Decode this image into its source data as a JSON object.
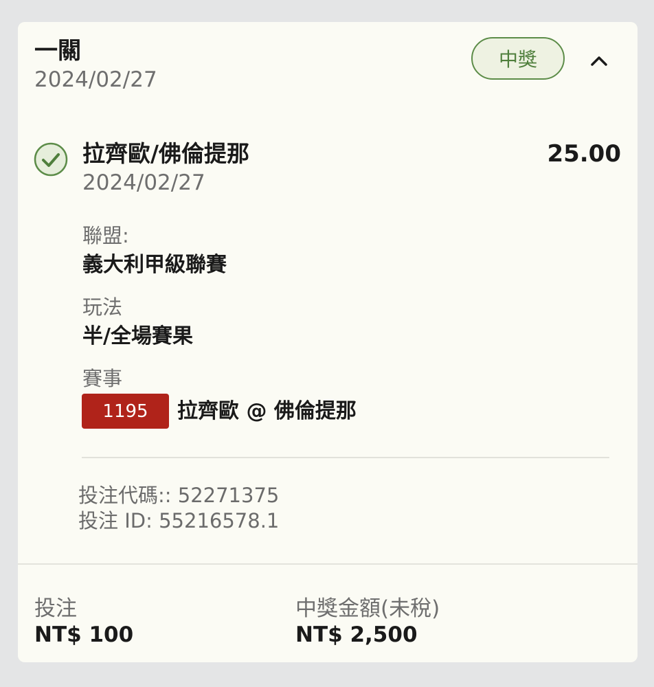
{
  "header": {
    "title": "一關",
    "date": "2024/02/27",
    "status": "中獎"
  },
  "selection": {
    "title": "拉齊歐/佛倫提那",
    "date": "2024/02/27",
    "odds": "25.00",
    "league_label": "聯盟:",
    "league_value": "義大利甲級聯賽",
    "bet_type_label": "玩法",
    "bet_type_value": "半/全場賽果",
    "event_label": "賽事",
    "event_code": "1195",
    "event_name": "拉齊歐 @ 佛倫提那"
  },
  "meta": {
    "bet_code": "投注代碼:: 52271375",
    "bet_id": "投注 ID: 55216578.1"
  },
  "footer": {
    "stake_label": "投注",
    "stake_value": "NT$ 100",
    "payout_label": "中獎金額(未稅)",
    "payout_value": "NT$ 2,500"
  },
  "icons": {
    "collapse": "chevron-up-icon",
    "status": "check-circle-icon"
  },
  "colors": {
    "win_green": "#4f7f3c",
    "event_red": "#b0231a",
    "card_bg": "#fbfbf4"
  }
}
